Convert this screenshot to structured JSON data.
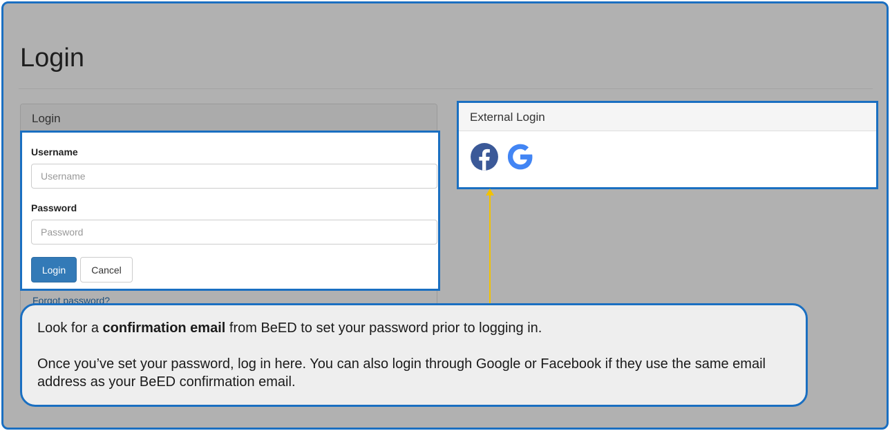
{
  "page": {
    "title": "Login"
  },
  "login_panel": {
    "heading": "Login",
    "username_label": "Username",
    "username_placeholder": "Username",
    "password_label": "Password",
    "password_placeholder": "Password",
    "login_button": "Login",
    "cancel_button": "Cancel",
    "forgot_link": "Forgot password?"
  },
  "external_login": {
    "heading": "External Login",
    "providers": [
      {
        "name": "facebook-icon",
        "color": "#3b5998"
      },
      {
        "name": "google-icon",
        "color": "#4285f4"
      }
    ]
  },
  "callout": {
    "line1_before": "Look for a ",
    "line1_bold": "confirmation email",
    "line1_after": " from BeED to set your password prior to logging in.",
    "line2": "Once you’ve set your password, log in here. You can also login through Google or Facebook if they use the same email address as your BeED confirmation email."
  },
  "colors": {
    "highlight_border": "#1a6fc1",
    "overlay": "#b1b1b1",
    "primary_button": "#337ab7",
    "arrow": "#f2c200"
  }
}
